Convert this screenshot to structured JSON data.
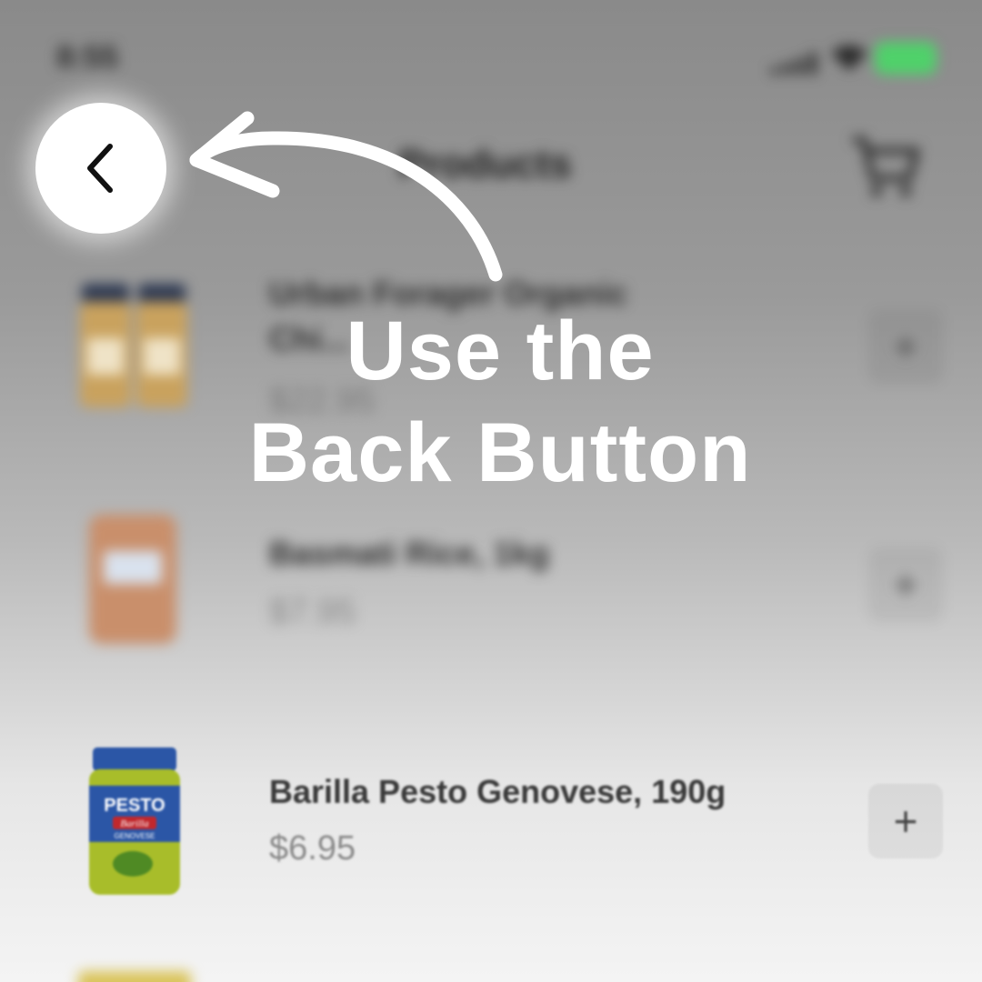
{
  "status_bar": {
    "time": "8:55",
    "battery_color": "#4fd16a"
  },
  "nav": {
    "title": "Products",
    "back_icon": "chevron-left-icon",
    "cart_icon": "cart-icon"
  },
  "products": [
    {
      "name_line1": "Urban Forager Organic",
      "name_line2": "Chi...",
      "price": "$22.95",
      "add_label": "+"
    },
    {
      "name": "Basmati Rice, 1kg",
      "price": "$7.95",
      "add_label": "+"
    },
    {
      "name": "Barilla Pesto Genovese, 190g",
      "price": "$6.95",
      "add_label": "+",
      "jar_label": "PESTO",
      "jar_brand": "Barilla",
      "jar_variant": "GENOVESE"
    }
  ],
  "callout": {
    "line1": "Use the",
    "line2": "Back Button"
  }
}
